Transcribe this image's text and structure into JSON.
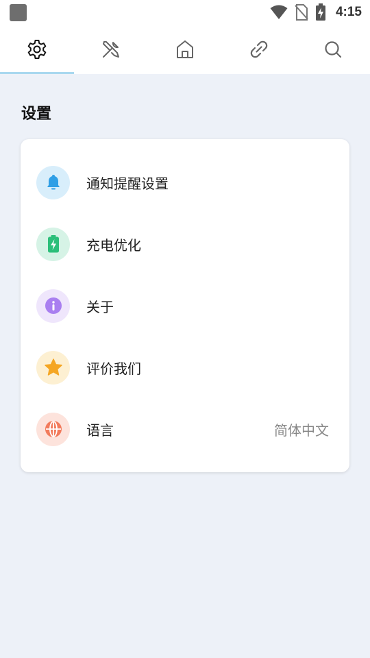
{
  "status_bar": {
    "time": "4:15",
    "icons": [
      "app-icon",
      "wifi-icon",
      "no-sim-icon",
      "battery-charging-icon"
    ]
  },
  "tabs": [
    {
      "icon": "gear-icon",
      "active": true
    },
    {
      "icon": "tools-icon",
      "active": false
    },
    {
      "icon": "home-icon",
      "active": false
    },
    {
      "icon": "link-icon",
      "active": false
    },
    {
      "icon": "search-icon",
      "active": false
    }
  ],
  "colors": {
    "background": "#edf1f8",
    "tab_indicator": "#a9d8ef",
    "notify": "#2f9fe6",
    "charge": "#2cbf7a",
    "about": "#a97ff0",
    "rate": "#f5a623",
    "language": "#f27b5c"
  },
  "settings": {
    "title": "设置",
    "items": [
      {
        "label": "通知提醒设置",
        "icon": "bell-icon"
      },
      {
        "label": "充电优化",
        "icon": "battery-icon"
      },
      {
        "label": "关于",
        "icon": "info-icon"
      },
      {
        "label": "评价我们",
        "icon": "star-icon"
      },
      {
        "label": "语言",
        "icon": "globe-icon",
        "value": "简体中文"
      }
    ]
  }
}
